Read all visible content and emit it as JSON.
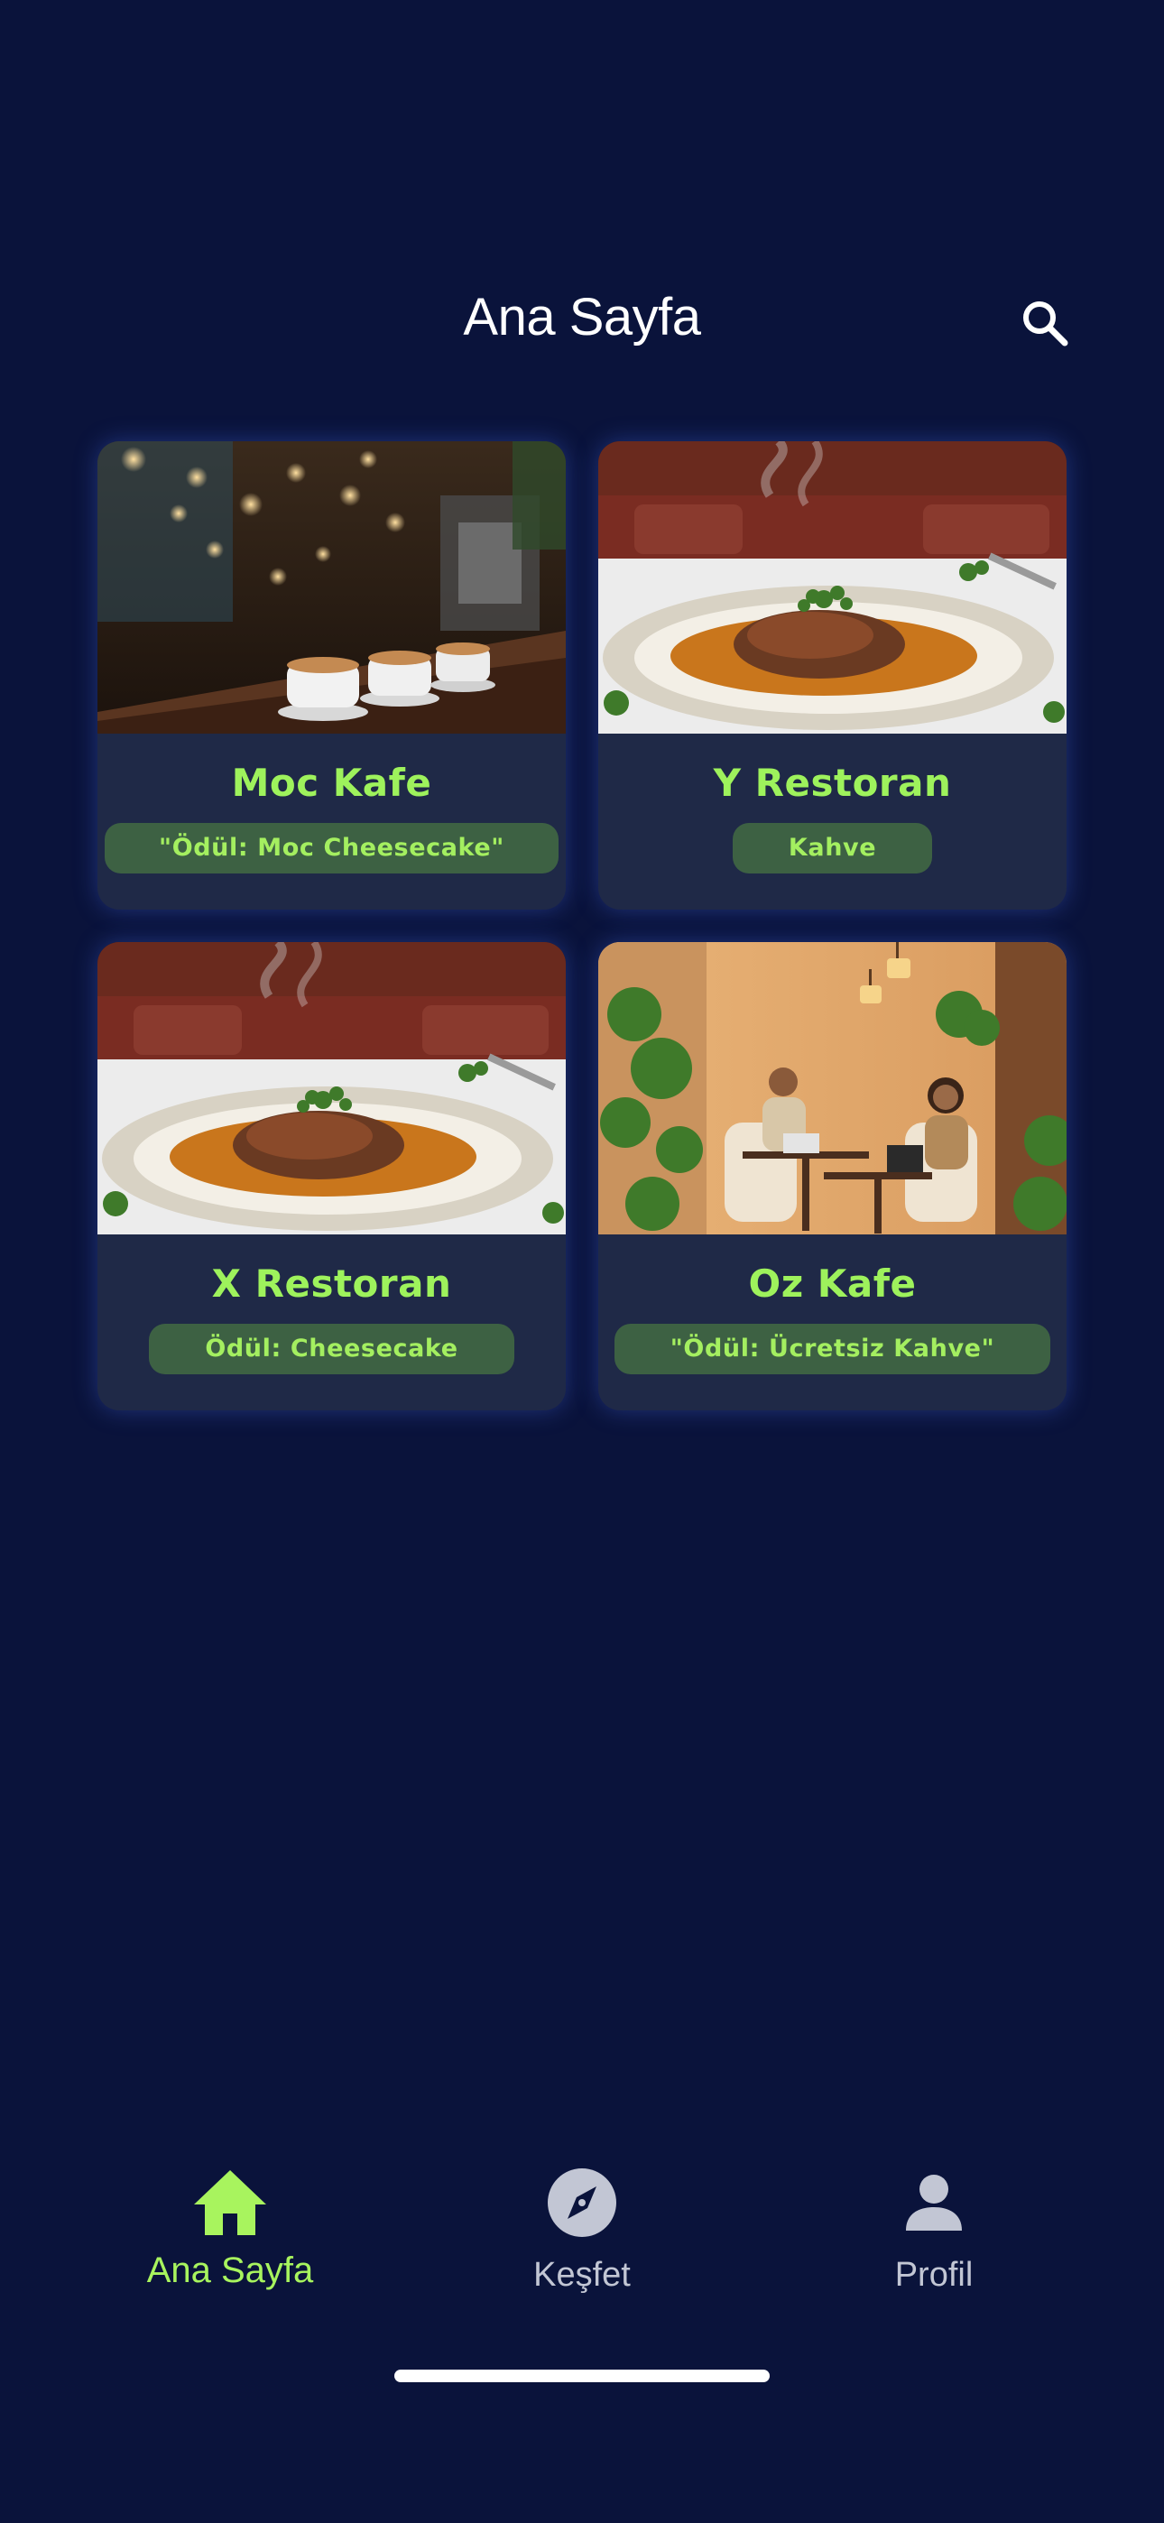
{
  "header": {
    "title": "Ana Sayfa",
    "search_icon": "search-icon"
  },
  "venues": [
    {
      "name": "Moc Kafe",
      "badge": "\"Ödül: Moc Cheesecake\"",
      "image": "cafe-interior-coffee-cups"
    },
    {
      "name": "Y Restoran",
      "badge": "Kahve",
      "image": "plated-meat-dish"
    },
    {
      "name": "X Restoran",
      "badge": "Ödül: Cheesecake",
      "image": "plated-meat-dish"
    },
    {
      "name": "Oz Kafe",
      "badge": "\"Ödül: Ücretsiz Kahve\"",
      "image": "cafe-people-laptops"
    }
  ],
  "bottom_nav": {
    "items": [
      {
        "label": "Ana Sayfa",
        "icon": "home-icon",
        "active": true
      },
      {
        "label": "Keşfet",
        "icon": "compass-icon",
        "active": false
      },
      {
        "label": "Profil",
        "icon": "person-icon",
        "active": false
      }
    ]
  },
  "colors": {
    "background": "#0a133b",
    "card": "#1f2947",
    "accent": "#9ef25c",
    "badge_bg": "#3d6143",
    "inactive": "#c2c6d4"
  }
}
